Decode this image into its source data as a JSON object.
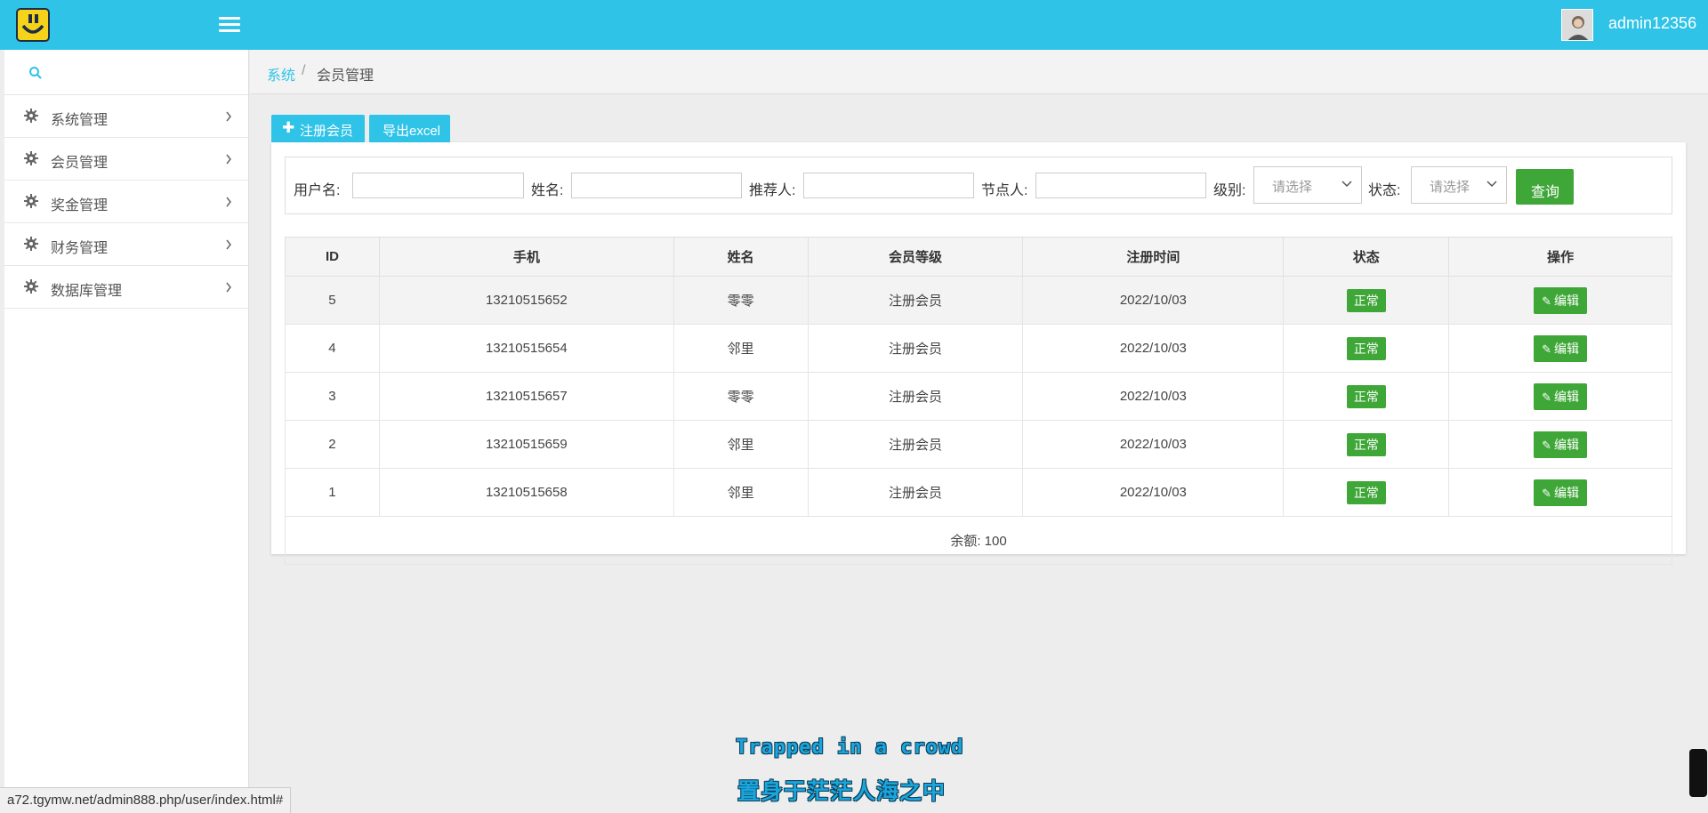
{
  "header": {
    "username": "admin12356"
  },
  "sidebar": {
    "items": [
      {
        "label": "系统管理"
      },
      {
        "label": "会员管理"
      },
      {
        "label": "奖金管理"
      },
      {
        "label": "财务管理"
      },
      {
        "label": "数据库管理"
      }
    ]
  },
  "breadcrumb": {
    "root": "系统",
    "separator": "/",
    "current": "会员管理"
  },
  "toolbar": {
    "register_label": "注册会员",
    "export_label": "导出excel"
  },
  "filters": {
    "username_label": "用户名:",
    "name_label": "姓名:",
    "referrer_label": "推荐人:",
    "node_label": "节点人:",
    "level_label": "级别:",
    "level_value": "请选择",
    "status_label": "状态:",
    "status_value": "请选择",
    "search_label": "查询"
  },
  "table": {
    "columns": [
      "ID",
      "手机",
      "姓名",
      "会员等级",
      "注册时间",
      "状态",
      "操作"
    ],
    "rows": [
      {
        "id": "5",
        "phone": "13210515652",
        "name": "零零",
        "level": "注册会员",
        "date": "2022/10/03",
        "status": "正常",
        "action": "编辑"
      },
      {
        "id": "4",
        "phone": "13210515654",
        "name": "邻里",
        "level": "注册会员",
        "date": "2022/10/03",
        "status": "正常",
        "action": "编辑"
      },
      {
        "id": "3",
        "phone": "13210515657",
        "name": "零零",
        "level": "注册会员",
        "date": "2022/10/03",
        "status": "正常",
        "action": "编辑"
      },
      {
        "id": "2",
        "phone": "13210515659",
        "name": "邻里",
        "level": "注册会员",
        "date": "2022/10/03",
        "status": "正常",
        "action": "编辑"
      },
      {
        "id": "1",
        "phone": "13210515658",
        "name": "邻里",
        "level": "注册会员",
        "date": "2022/10/03",
        "status": "正常",
        "action": "编辑"
      }
    ],
    "summary": "余额: 100"
  },
  "statusbar": {
    "url": "a72.tgymw.net/admin888.php/user/index.html#"
  },
  "subtitles": {
    "line1": "Trapped in a crowd",
    "line2": "置身于茫茫人海之中"
  },
  "colors": {
    "accent": "#2fc3e8",
    "success": "#3fa638",
    "link": "#337ab7"
  }
}
